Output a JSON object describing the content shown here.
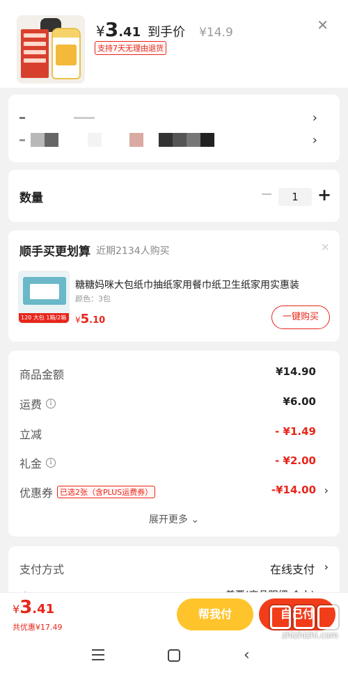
{
  "product": {
    "price_symbol": "¥",
    "price_int": "3",
    "price_dec": ".41",
    "price_label": "到手价",
    "original_price": "¥14.9",
    "return_badge": "支持7天无理由退货",
    "close_icon": "close-icon"
  },
  "spec": {
    "row_chevron": "›"
  },
  "quantity": {
    "label": "数量",
    "minus": "−",
    "value": "1",
    "plus": "+"
  },
  "bundle": {
    "title": "顺手买更划算",
    "subtitle": "近期2134人购买",
    "close": "×",
    "item_name": "糖糖妈咪大包纸巾抽纸家用餐巾纸卫生纸家用实惠装",
    "item_color": "颜色：3包",
    "image_strip": "120 大包 1箱/2箱",
    "price_symbol": "¥",
    "price_int": "5",
    "price_dec": ".10",
    "buy_button": "一键购买"
  },
  "summary": {
    "rows": [
      {
        "label": "商品金额",
        "value": "¥14.90"
      },
      {
        "label": "运费",
        "value": "¥6.00"
      },
      {
        "label": "立减",
        "value": "- ¥1.49"
      },
      {
        "label": "礼金",
        "value": "- ¥2.00"
      },
      {
        "label": "优惠券",
        "value": "-¥14.00",
        "badge": "已选2张（含PLUS运费券）"
      }
    ],
    "expand_more": "展开更多 ⌄"
  },
  "payment": {
    "label": "支付方式",
    "value": "在线支付",
    "invoice_label": "发票",
    "invoice_value": "普票(商品明细-个人)"
  },
  "bottom": {
    "price_symbol": "¥",
    "price_int": "3",
    "price_dec": ".41",
    "discount_text": "共优惠¥17.49",
    "help_pay": "帮我付",
    "self_pay": "自己付"
  },
  "watermark": {
    "url": "zhizhizhi.com"
  },
  "colors": {
    "accent_red": "#e8251a",
    "help_button": "#ffc42b",
    "self_button": "#f23d1a"
  }
}
